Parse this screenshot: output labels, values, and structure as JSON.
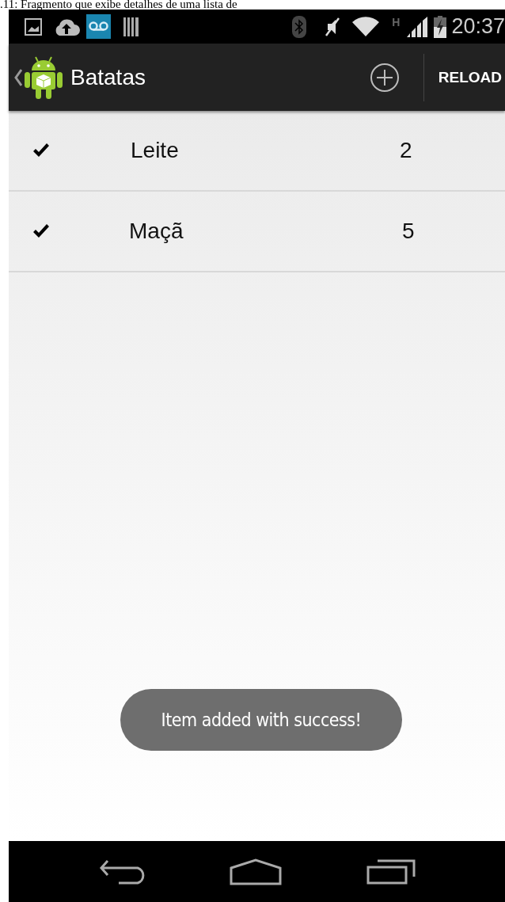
{
  "caption": ".11: Fragmento que exibe detalhes de uma lista de",
  "status_bar": {
    "network_type": "H",
    "time": "20:37"
  },
  "action_bar": {
    "title": "Batatas",
    "action": "RELOAD"
  },
  "items": [
    {
      "name": "Leite",
      "quantity": "2",
      "checked": true
    },
    {
      "name": "Maçã",
      "quantity": "5",
      "checked": true
    }
  ],
  "toast": "Item added with success!"
}
